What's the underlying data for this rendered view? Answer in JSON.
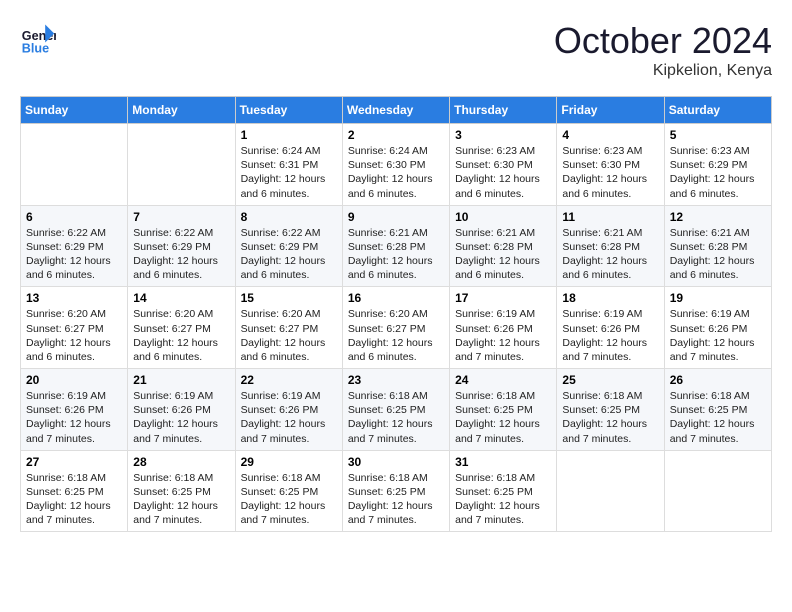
{
  "header": {
    "logo_line1": "General",
    "logo_line2": "Blue",
    "month": "October 2024",
    "location": "Kipkelion, Kenya"
  },
  "days_of_week": [
    "Sunday",
    "Monday",
    "Tuesday",
    "Wednesday",
    "Thursday",
    "Friday",
    "Saturday"
  ],
  "weeks": [
    [
      {
        "day": "",
        "text": ""
      },
      {
        "day": "",
        "text": ""
      },
      {
        "day": "1",
        "text": "Sunrise: 6:24 AM\nSunset: 6:31 PM\nDaylight: 12 hours and 6 minutes."
      },
      {
        "day": "2",
        "text": "Sunrise: 6:24 AM\nSunset: 6:30 PM\nDaylight: 12 hours and 6 minutes."
      },
      {
        "day": "3",
        "text": "Sunrise: 6:23 AM\nSunset: 6:30 PM\nDaylight: 12 hours and 6 minutes."
      },
      {
        "day": "4",
        "text": "Sunrise: 6:23 AM\nSunset: 6:30 PM\nDaylight: 12 hours and 6 minutes."
      },
      {
        "day": "5",
        "text": "Sunrise: 6:23 AM\nSunset: 6:29 PM\nDaylight: 12 hours and 6 minutes."
      }
    ],
    [
      {
        "day": "6",
        "text": "Sunrise: 6:22 AM\nSunset: 6:29 PM\nDaylight: 12 hours and 6 minutes."
      },
      {
        "day": "7",
        "text": "Sunrise: 6:22 AM\nSunset: 6:29 PM\nDaylight: 12 hours and 6 minutes."
      },
      {
        "day": "8",
        "text": "Sunrise: 6:22 AM\nSunset: 6:29 PM\nDaylight: 12 hours and 6 minutes."
      },
      {
        "day": "9",
        "text": "Sunrise: 6:21 AM\nSunset: 6:28 PM\nDaylight: 12 hours and 6 minutes."
      },
      {
        "day": "10",
        "text": "Sunrise: 6:21 AM\nSunset: 6:28 PM\nDaylight: 12 hours and 6 minutes."
      },
      {
        "day": "11",
        "text": "Sunrise: 6:21 AM\nSunset: 6:28 PM\nDaylight: 12 hours and 6 minutes."
      },
      {
        "day": "12",
        "text": "Sunrise: 6:21 AM\nSunset: 6:28 PM\nDaylight: 12 hours and 6 minutes."
      }
    ],
    [
      {
        "day": "13",
        "text": "Sunrise: 6:20 AM\nSunset: 6:27 PM\nDaylight: 12 hours and 6 minutes."
      },
      {
        "day": "14",
        "text": "Sunrise: 6:20 AM\nSunset: 6:27 PM\nDaylight: 12 hours and 6 minutes."
      },
      {
        "day": "15",
        "text": "Sunrise: 6:20 AM\nSunset: 6:27 PM\nDaylight: 12 hours and 6 minutes."
      },
      {
        "day": "16",
        "text": "Sunrise: 6:20 AM\nSunset: 6:27 PM\nDaylight: 12 hours and 6 minutes."
      },
      {
        "day": "17",
        "text": "Sunrise: 6:19 AM\nSunset: 6:26 PM\nDaylight: 12 hours and 7 minutes."
      },
      {
        "day": "18",
        "text": "Sunrise: 6:19 AM\nSunset: 6:26 PM\nDaylight: 12 hours and 7 minutes."
      },
      {
        "day": "19",
        "text": "Sunrise: 6:19 AM\nSunset: 6:26 PM\nDaylight: 12 hours and 7 minutes."
      }
    ],
    [
      {
        "day": "20",
        "text": "Sunrise: 6:19 AM\nSunset: 6:26 PM\nDaylight: 12 hours and 7 minutes."
      },
      {
        "day": "21",
        "text": "Sunrise: 6:19 AM\nSunset: 6:26 PM\nDaylight: 12 hours and 7 minutes."
      },
      {
        "day": "22",
        "text": "Sunrise: 6:19 AM\nSunset: 6:26 PM\nDaylight: 12 hours and 7 minutes."
      },
      {
        "day": "23",
        "text": "Sunrise: 6:18 AM\nSunset: 6:25 PM\nDaylight: 12 hours and 7 minutes."
      },
      {
        "day": "24",
        "text": "Sunrise: 6:18 AM\nSunset: 6:25 PM\nDaylight: 12 hours and 7 minutes."
      },
      {
        "day": "25",
        "text": "Sunrise: 6:18 AM\nSunset: 6:25 PM\nDaylight: 12 hours and 7 minutes."
      },
      {
        "day": "26",
        "text": "Sunrise: 6:18 AM\nSunset: 6:25 PM\nDaylight: 12 hours and 7 minutes."
      }
    ],
    [
      {
        "day": "27",
        "text": "Sunrise: 6:18 AM\nSunset: 6:25 PM\nDaylight: 12 hours and 7 minutes."
      },
      {
        "day": "28",
        "text": "Sunrise: 6:18 AM\nSunset: 6:25 PM\nDaylight: 12 hours and 7 minutes."
      },
      {
        "day": "29",
        "text": "Sunrise: 6:18 AM\nSunset: 6:25 PM\nDaylight: 12 hours and 7 minutes."
      },
      {
        "day": "30",
        "text": "Sunrise: 6:18 AM\nSunset: 6:25 PM\nDaylight: 12 hours and 7 minutes."
      },
      {
        "day": "31",
        "text": "Sunrise: 6:18 AM\nSunset: 6:25 PM\nDaylight: 12 hours and 7 minutes."
      },
      {
        "day": "",
        "text": ""
      },
      {
        "day": "",
        "text": ""
      }
    ]
  ]
}
